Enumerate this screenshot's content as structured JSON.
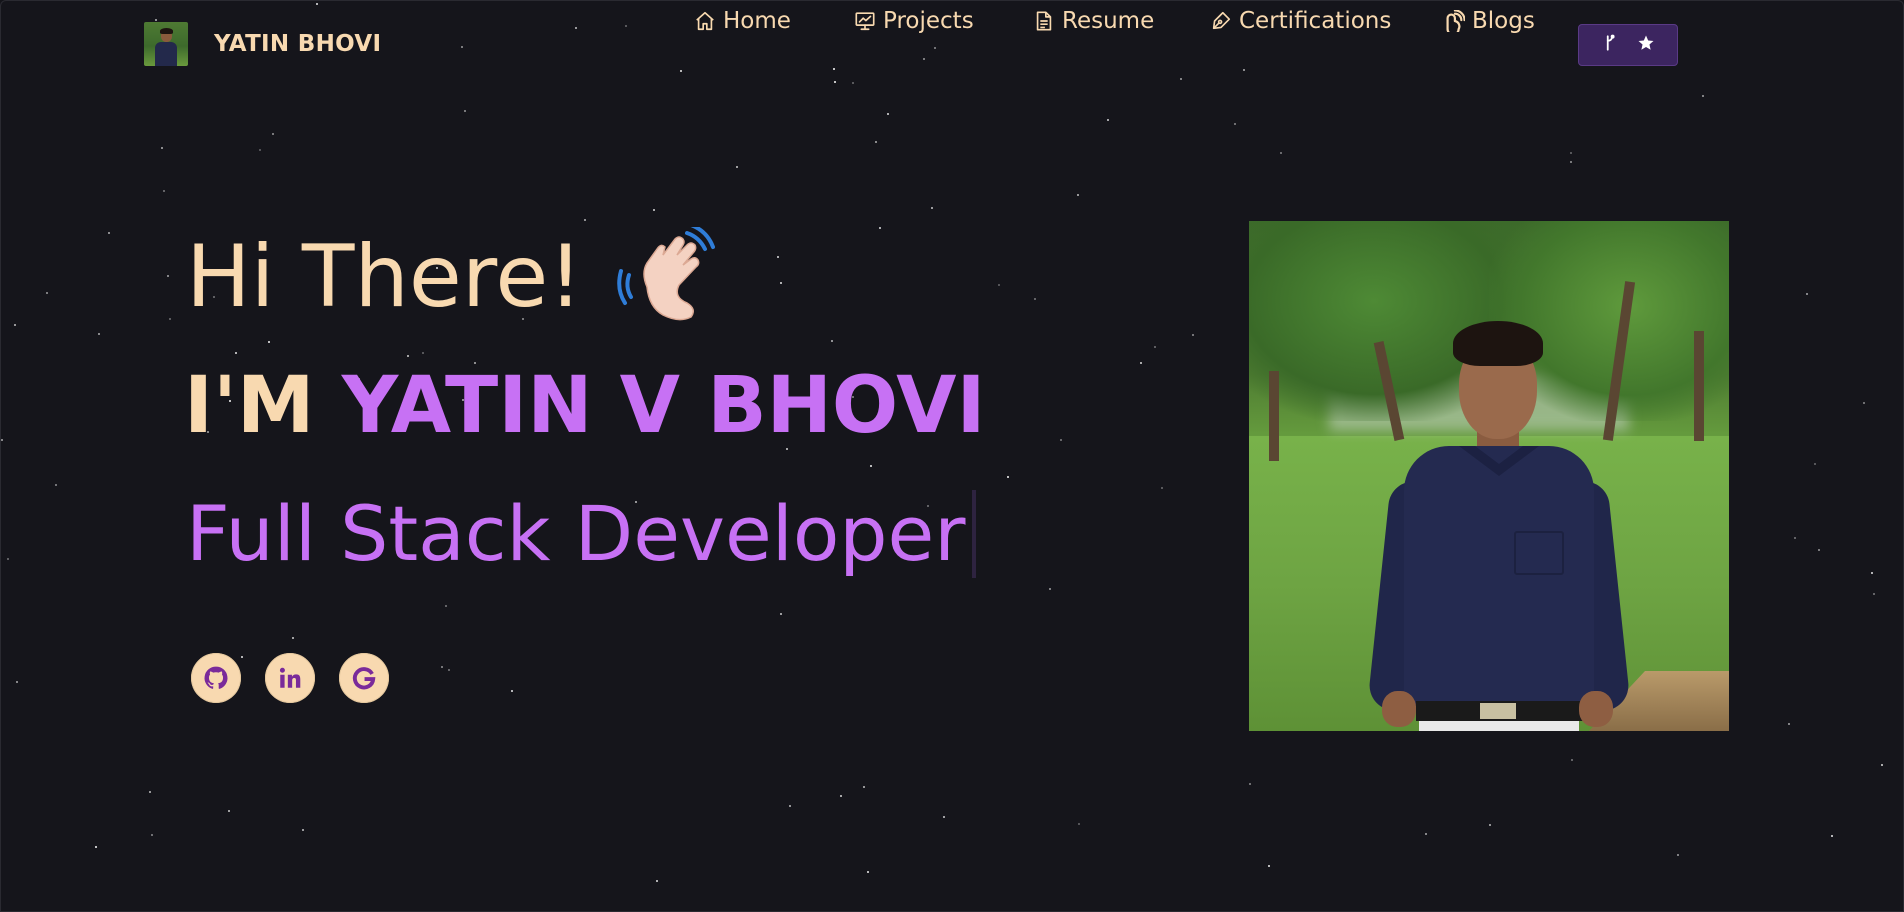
{
  "brand": {
    "name": "YATIN BHOVI",
    "avatar": "profile-thumbnail"
  },
  "nav": {
    "items": [
      {
        "label": "Home",
        "icon": "home-icon"
      },
      {
        "label": "Projects",
        "icon": "presentation-icon"
      },
      {
        "label": "Resume",
        "icon": "document-icon"
      },
      {
        "label": "Certifications",
        "icon": "fountain-pen-icon"
      },
      {
        "label": "Blogs",
        "icon": "blogger-icon"
      }
    ],
    "github_button": {
      "icons": [
        "git-fork-icon",
        "star-icon"
      ]
    }
  },
  "hero": {
    "greeting": "Hi There!",
    "greeting_emoji": "waving-hand",
    "im_prefix": "I'M ",
    "name": "YATIN V BHOVI",
    "role": "Full Stack Developer"
  },
  "socials": [
    {
      "name": "github",
      "icon": "github-icon"
    },
    {
      "name": "linkedin",
      "icon": "linkedin-icon"
    },
    {
      "name": "google",
      "icon": "google-icon"
    }
  ],
  "colors": {
    "background": "#141419",
    "text": "#f8d9b0",
    "accent": "#c771f4",
    "button": "#3c2560"
  }
}
